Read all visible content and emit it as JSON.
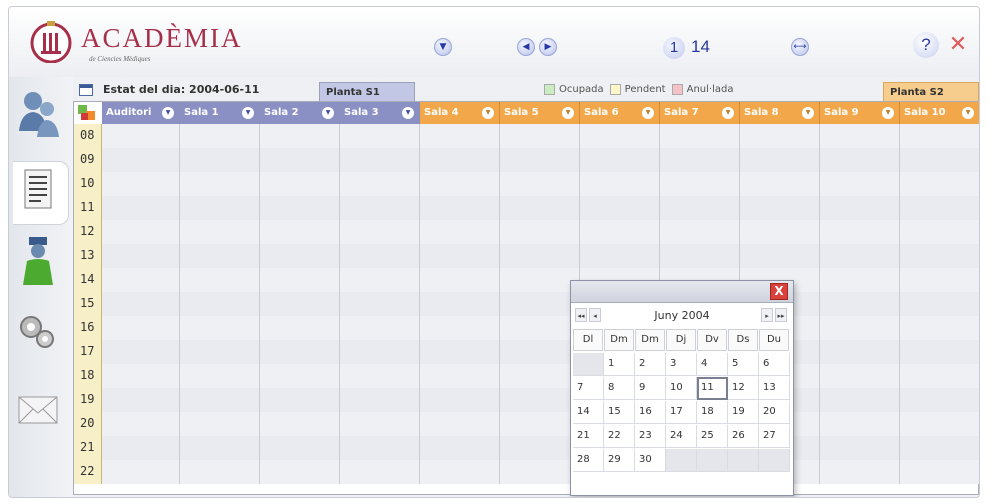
{
  "header": {
    "logo_title": "ACADÈMIA",
    "logo_subtitle": "de Ciencies Mèdiques",
    "page_current": "1",
    "page_total": "14",
    "help_label": "?",
    "close_label": "✕"
  },
  "status": {
    "text": "Estat del dia: 2004-06-11",
    "plant_s1": "Planta S1",
    "plant_s2": "Planta S2",
    "legend": [
      {
        "label": "Ocupada",
        "color": "#c9ecc0"
      },
      {
        "label": "Pendent",
        "color": "#fdf6c8"
      },
      {
        "label": "Anul·lada",
        "color": "#f5c2c8"
      }
    ]
  },
  "columns": [
    {
      "label": "Auditori",
      "group": "S1"
    },
    {
      "label": "Sala 1",
      "group": "S1"
    },
    {
      "label": "Sala 2",
      "group": "S1"
    },
    {
      "label": "Sala 3",
      "group": "S1"
    },
    {
      "label": "Sala 4",
      "group": "S2"
    },
    {
      "label": "Sala 5",
      "group": "S2"
    },
    {
      "label": "Sala 6",
      "group": "S2"
    },
    {
      "label": "Sala 7",
      "group": "S2"
    },
    {
      "label": "Sala 8",
      "group": "S2"
    },
    {
      "label": "Sala 9",
      "group": "S2"
    },
    {
      "label": "Sala 10",
      "group": "S2"
    }
  ],
  "hours": [
    "08",
    "09",
    "10",
    "11",
    "12",
    "13",
    "14",
    "15",
    "16",
    "17",
    "18",
    "19",
    "20",
    "21",
    "22"
  ],
  "datepicker": {
    "close_label": "X",
    "month_label": "Juny 2004",
    "nav": {
      "prev_year": "◂◂",
      "prev_month": "◂",
      "next_month": "▸",
      "next_year": "▸▸"
    },
    "weekdays": [
      "Dl",
      "Dm",
      "Dm",
      "Dj",
      "Dv",
      "Ds",
      "Du"
    ],
    "first_weekday_offset": 1,
    "days_in_month": 30,
    "selected_day": 11
  },
  "sidebar": {
    "icons": [
      "users-icon",
      "document-list-icon",
      "person-icon",
      "gears-icon",
      "mail-icon"
    ]
  }
}
